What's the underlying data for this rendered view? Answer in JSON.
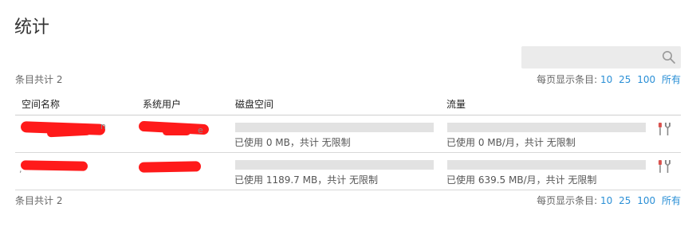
{
  "page": {
    "title": "统计"
  },
  "search": {
    "value": ""
  },
  "summary": {
    "count_label": "条目共计 2"
  },
  "pagination": {
    "per_page_label": "每页显示条目:",
    "options": [
      "10",
      "25",
      "100",
      "所有"
    ]
  },
  "table": {
    "columns": [
      "空间名称",
      "系统用户",
      "磁盘空间",
      "流量"
    ],
    "rows": [
      {
        "space_name": "",
        "system_user": "",
        "disk_text": "已使用 0 MB，共计 无限制",
        "disk_fraction": 0,
        "traffic_text": "已使用 0 MB/月，共计 无限制",
        "traffic_fraction": 0,
        "tool_icon": "tools-icon"
      },
      {
        "space_name": "",
        "system_user": "",
        "disk_text": "已使用 1189.7 MB，共计 无限制",
        "disk_fraction": 0,
        "traffic_text": "已使用 639.5 MB/月，共计 无限制",
        "traffic_fraction": 0,
        "tool_icon": "tools-icon"
      }
    ]
  },
  "footer": {
    "count_label": "条目共计 2",
    "per_page_label": "每页显示条目:",
    "options": [
      "10",
      "25",
      "100",
      "所有"
    ]
  },
  "colors": {
    "link": "#2a8fd6",
    "redaction": "#ff1a1a",
    "bar_track": "#e2e2e2",
    "tool_red": "#d9534f",
    "tool_gray": "#8a8a8a"
  }
}
